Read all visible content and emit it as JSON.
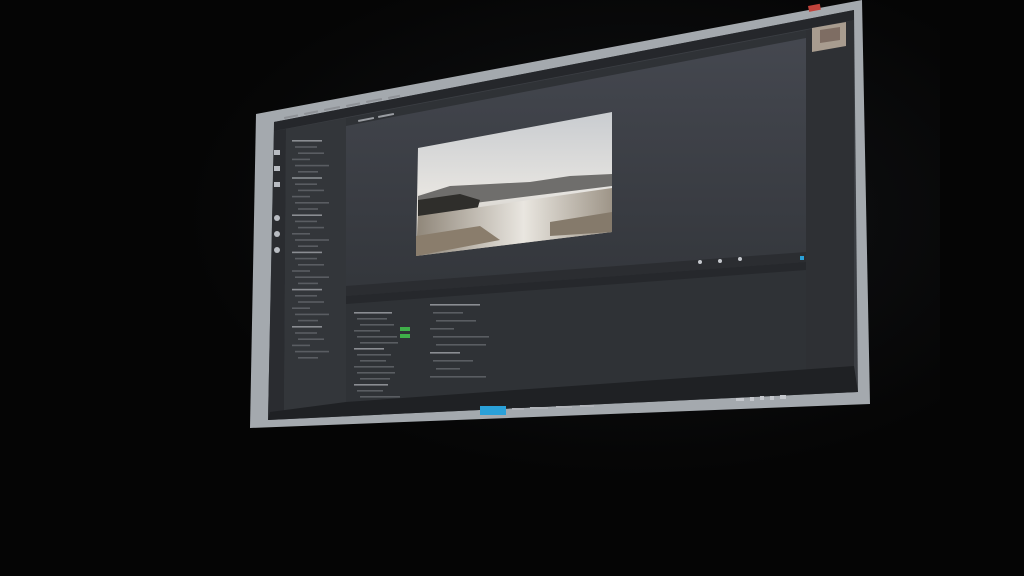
{
  "scene": {
    "description_free": true,
    "colors": {
      "wall": "#050505",
      "screen_bezel": "#a8adb2",
      "app_bg": "#3a3d42",
      "panel_bg": "#2e3034",
      "viewport_bg": "#4a4d52",
      "accent": "#2aa0d8",
      "green_badge": "#3fae49"
    }
  },
  "app": {
    "bottom_tabs": [
      {
        "label": "",
        "active": true
      },
      {
        "label": "",
        "active": false
      },
      {
        "label": "",
        "active": false
      },
      {
        "label": "",
        "active": false
      },
      {
        "label": "",
        "active": false
      }
    ],
    "icons": {
      "left_toolbar": [
        "tool-icon-1",
        "tool-icon-2",
        "tool-icon-3",
        "tool-icon-4",
        "tool-icon-5",
        "tool-icon-6"
      ],
      "viewport_controls": [
        "play-icon",
        "settings-icon",
        "fullscreen-icon"
      ]
    }
  }
}
